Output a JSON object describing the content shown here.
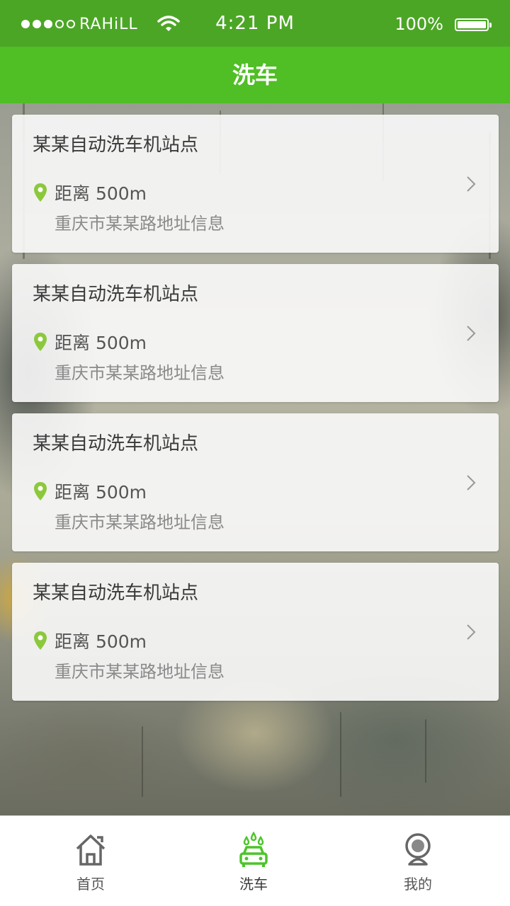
{
  "status_bar": {
    "carrier": "RAHiLL",
    "time": "4:21 PM",
    "battery": "100%"
  },
  "nav": {
    "title": "洗车"
  },
  "stations": [
    {
      "name": "某某自动洗车机站点",
      "distance": "距离 500m",
      "address": "重庆市某某路地址信息"
    },
    {
      "name": "某某自动洗车机站点",
      "distance": "距离 500m",
      "address": "重庆市某某路地址信息"
    },
    {
      "name": "某某自动洗车机站点",
      "distance": "距离 500m",
      "address": "重庆市某某路地址信息"
    },
    {
      "name": "某某自动洗车机站点",
      "distance": "距离 500m",
      "address": "重庆市某某路地址信息"
    }
  ],
  "tabs": [
    {
      "label": "首页",
      "icon": "home-icon",
      "active": false
    },
    {
      "label": "洗车",
      "icon": "car-wash-icon",
      "active": true
    },
    {
      "label": "我的",
      "icon": "profile-icon",
      "active": false
    }
  ],
  "colors": {
    "status_bar": "#4ca626",
    "nav_bar": "#50be25",
    "accent": "#4cc42a",
    "pin": "#8cc83c"
  }
}
